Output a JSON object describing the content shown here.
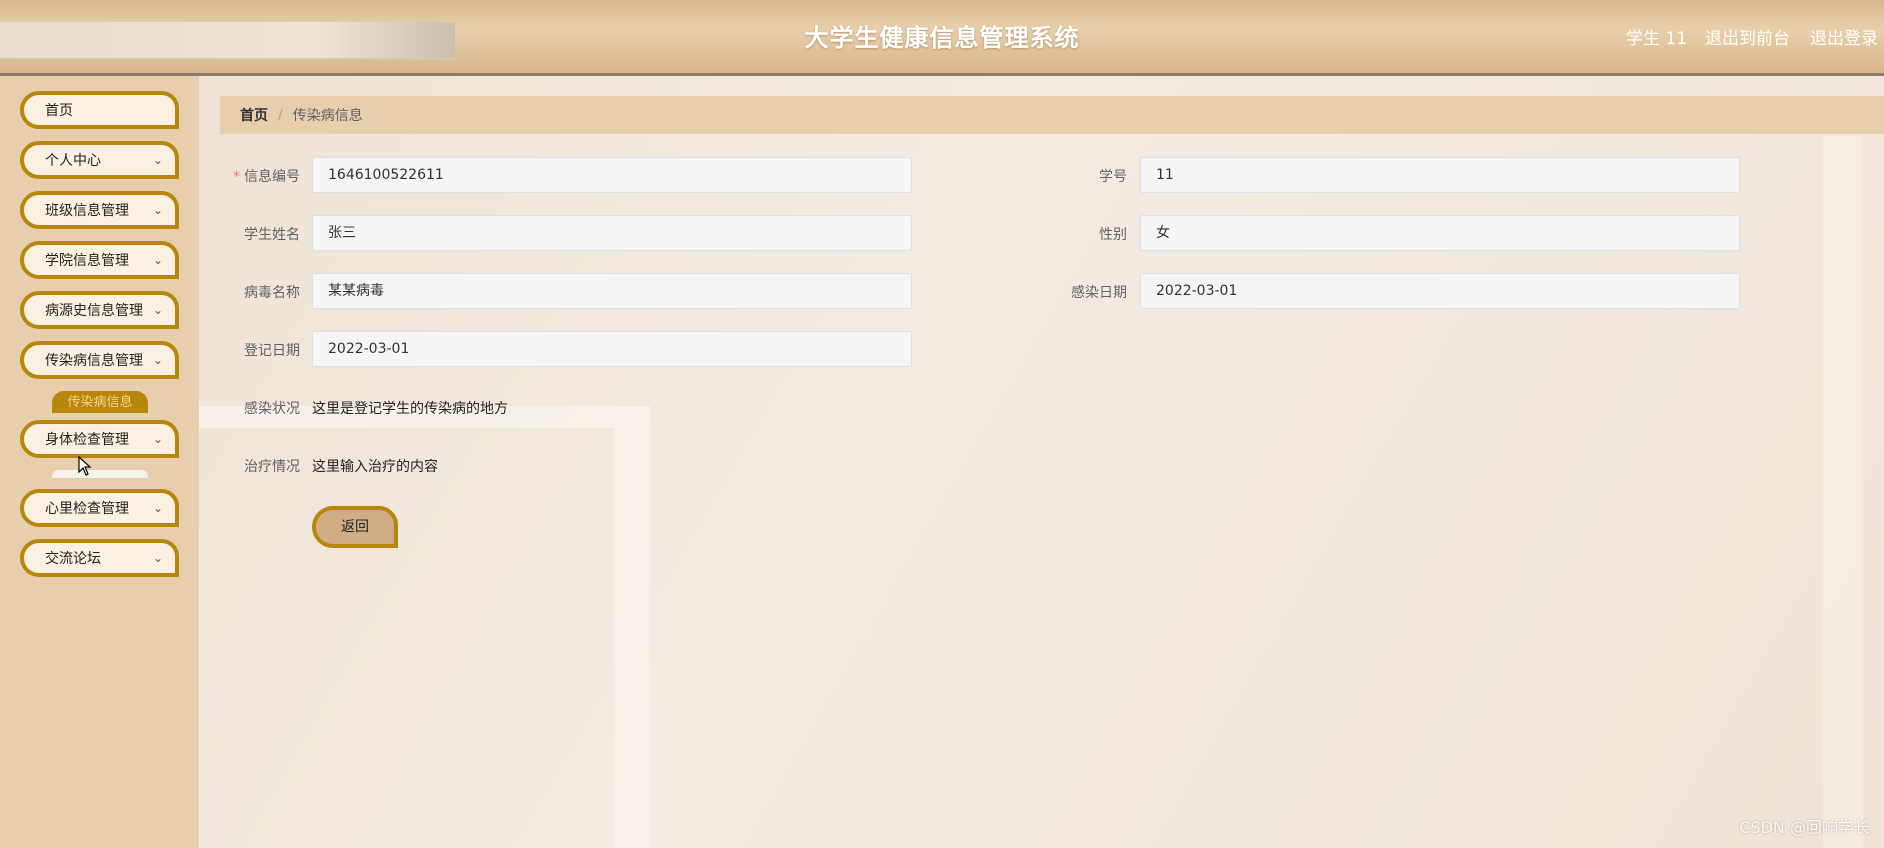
{
  "header": {
    "title": "大学生健康信息管理系统",
    "user_label": "学生 11",
    "front_link": "退出到前台",
    "logout_link": "退出登录"
  },
  "sidebar": {
    "items": [
      {
        "label": "首页"
      },
      {
        "label": "个人中心"
      },
      {
        "label": "班级信息管理"
      },
      {
        "label": "学院信息管理"
      },
      {
        "label": "病源史信息管理"
      },
      {
        "label": "传染病信息管理"
      },
      {
        "label": "身体检查管理"
      },
      {
        "label": "心里检查管理"
      },
      {
        "label": "交流论坛"
      }
    ],
    "active_subitem": "传染病信息",
    "chevron": "chevron-down-icon"
  },
  "breadcrumb": {
    "home": "首页",
    "separator": "/",
    "current": "传染病信息"
  },
  "form": {
    "info_no": {
      "label": "信息编号",
      "value": "1646100522611"
    },
    "student_no": {
      "label": "学号",
      "value": "11"
    },
    "student_name": {
      "label": "学生姓名",
      "value": "张三"
    },
    "gender": {
      "label": "性别",
      "value": "女"
    },
    "virus_name": {
      "label": "病毒名称",
      "value": "某某病毒"
    },
    "infect_date": {
      "label": "感染日期",
      "value": "2022-03-01"
    },
    "register_date": {
      "label": "登记日期",
      "value": "2022-03-01"
    },
    "infect_status": {
      "label": "感染状况",
      "value": "这里是登记学生的传染病的地方"
    },
    "treatment": {
      "label": "治疗情况",
      "value": "这里输入治疗的内容"
    },
    "back_label": "返回"
  },
  "watermark": "CSDN @回响学长"
}
